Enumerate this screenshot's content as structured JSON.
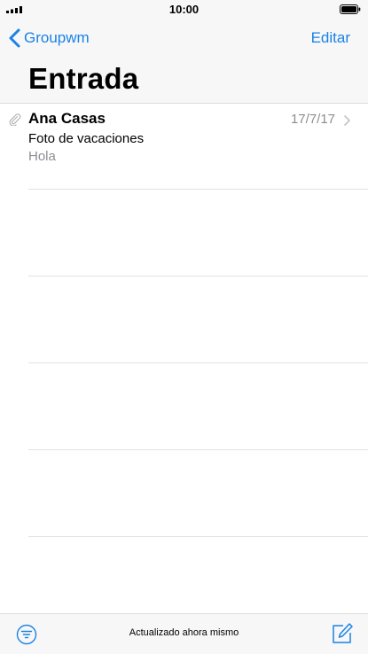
{
  "status_bar": {
    "time": "10:00",
    "signal_icon": "cellular-signal-icon",
    "battery_icon": "battery-icon"
  },
  "header": {
    "back_label": "Groupwm",
    "edit_label": "Editar",
    "title": "Entrada"
  },
  "messages": [
    {
      "sender": "Ana Casas",
      "date": "17/7/17",
      "subject": "Foto de vacaciones",
      "preview": "Hola",
      "has_attachment": true
    }
  ],
  "toolbar": {
    "status": "Actualizado ahora mismo",
    "filter_icon": "filter-icon",
    "compose_icon": "compose-icon"
  },
  "colors": {
    "accent": "#1a82e6",
    "secondary_text": "#8e8e93",
    "bar_background": "#f7f7f7",
    "separator": "#e2e2e2"
  }
}
